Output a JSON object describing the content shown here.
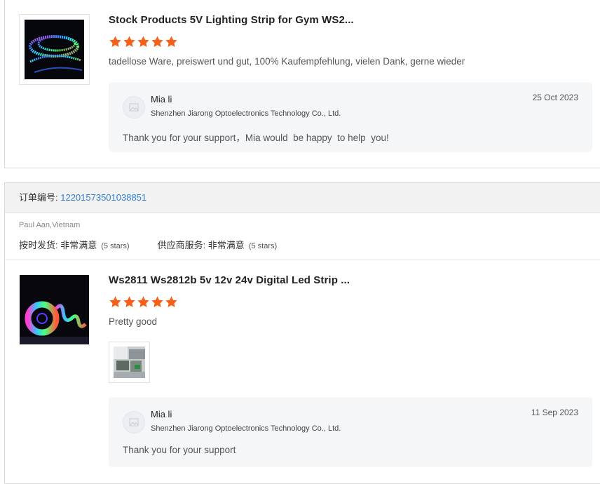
{
  "reviews": [
    {
      "product_title": "Stock Products 5V Lighting Strip for Gym WS2...",
      "rating": 5,
      "review_text": "tadellose Ware, preiswert und gut, 100% Kaufempfehlung, vielen Dank, gerne wieder",
      "reply": {
        "name": "Mia li",
        "company": "Shenzhen Jiarong Optoelectronics Technology Co., Ltd.",
        "date": "25 Oct 2023",
        "message": "Thank you for your support，Mia would  be happy  to help  you!"
      }
    },
    {
      "order_label": "订单编号: ",
      "order_number": "12201573501038851",
      "buyer": "Paul Aan,Vietnam",
      "delivery_label": "按时发货: 非常满意",
      "delivery_stars": "(5 stars)",
      "supplier_label": "供应商服务: 非常满意",
      "supplier_stars": "(5 stars)",
      "product_title": "Ws2811 Ws2812b 5v 12v 24v Digital Led Strip ...",
      "rating": 5,
      "review_text": "Pretty good",
      "reply": {
        "name": "Mia li",
        "company": "Shenzhen Jiarong Optoelectronics Technology Co., Ltd.",
        "date": "11 Sep 2023",
        "message": "Thank you for your support"
      }
    }
  ],
  "colors": {
    "star": "#f5611a",
    "link": "#2f7fd1",
    "reply_bg": "#f5f6f8"
  }
}
